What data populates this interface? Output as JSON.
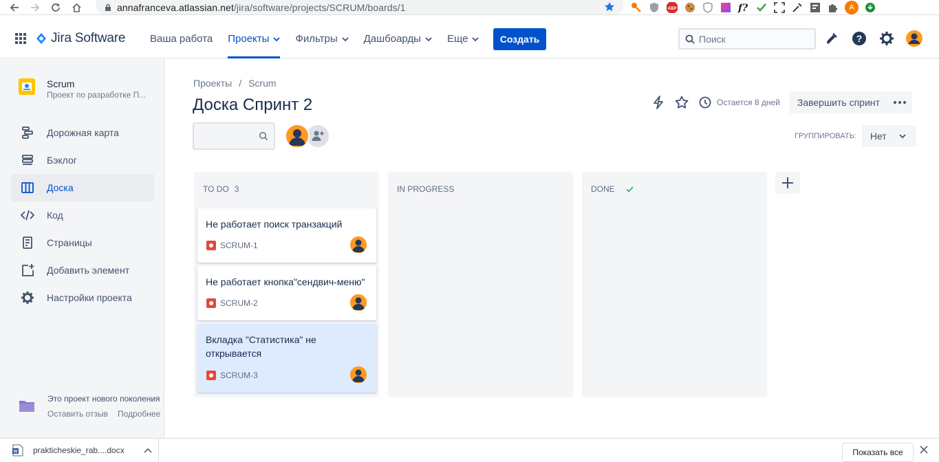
{
  "browser": {
    "url_host": "annafranceva.atlassian.net",
    "url_path": "/jira/software/projects/SCRUM/boards/1",
    "profile_initial": "A"
  },
  "topnav": {
    "product": "Jira Software",
    "menu": [
      {
        "label": "Ваша работа",
        "dropdown": false,
        "active": false
      },
      {
        "label": "Проекты",
        "dropdown": true,
        "active": true
      },
      {
        "label": "Фильтры",
        "dropdown": true,
        "active": false
      },
      {
        "label": "Дашбоарды",
        "dropdown": true,
        "active": false
      },
      {
        "label": "Еще",
        "dropdown": true,
        "active": false
      }
    ],
    "create_label": "Создать",
    "search_placeholder": "Поиск",
    "accent": "#0052cc"
  },
  "sidebar": {
    "project_name": "Scrum",
    "project_type": "Проект по разработке П...",
    "items": [
      {
        "label": "Дорожная карта",
        "icon": "roadmap-icon"
      },
      {
        "label": "Бэклог",
        "icon": "backlog-icon"
      },
      {
        "label": "Доска",
        "icon": "board-icon",
        "active": true
      },
      {
        "label": "Код",
        "icon": "code-icon"
      },
      {
        "label": "Страницы",
        "icon": "pages-icon"
      },
      {
        "label": "Добавить элемент",
        "icon": "add-item-icon"
      },
      {
        "label": "Настройки проекта",
        "icon": "settings-icon"
      }
    ],
    "footer_text": "Это проект нового поколения",
    "footer_link_feedback": "Оставить отзыв",
    "footer_link_more": "Подробнее"
  },
  "main": {
    "breadcrumb": [
      "Проекты",
      "Scrum"
    ],
    "title": "Доска Спринт 2",
    "remaining": "Остается 8 дней",
    "complete_sprint": "Завершить спринт",
    "group_by_label": "ГРУППИРОВАТЬ:",
    "group_by_value": "Нет"
  },
  "board": {
    "columns": [
      {
        "title": "TO DO",
        "count": "3",
        "cards": [
          {
            "summary": "Не работает поиск транзакций",
            "key": "SCRUM-1"
          },
          {
            "summary": "Не работает кнопка\"сендвич-меню\"",
            "key": "SCRUM-2"
          },
          {
            "summary": "Вкладка \"Статистика\" не открывается",
            "key": "SCRUM-3",
            "selected": true
          }
        ]
      },
      {
        "title": "IN PROGRESS",
        "cards": []
      },
      {
        "title": "DONE",
        "done": true,
        "cards": []
      }
    ]
  },
  "downloads": {
    "file_name": "prakticheskie_rab....docx",
    "show_all": "Показать все"
  }
}
